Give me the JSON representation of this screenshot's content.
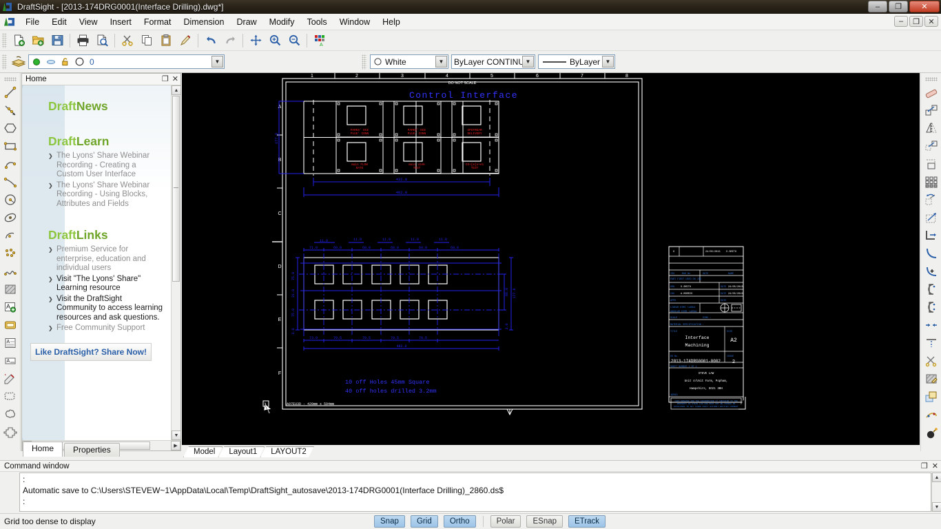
{
  "window": {
    "title": "DraftSight - [2013-174DRG0001(Interface Drilling).dwg*]",
    "minimize": "–",
    "restore": "❐",
    "close": "✕",
    "doc_minimize": "–",
    "doc_restore": "❐",
    "doc_close": "✕"
  },
  "menu": [
    {
      "label": "File"
    },
    {
      "label": "Edit"
    },
    {
      "label": "View"
    },
    {
      "label": "Insert"
    },
    {
      "label": "Format"
    },
    {
      "label": "Dimension"
    },
    {
      "label": "Draw"
    },
    {
      "label": "Modify"
    },
    {
      "label": "Tools"
    },
    {
      "label": "Window"
    },
    {
      "label": "Help"
    }
  ],
  "standard_toolbar": [
    {
      "name": "new-file-icon"
    },
    {
      "name": "open-file-icon"
    },
    {
      "name": "save-icon"
    },
    {
      "name": "print-icon"
    },
    {
      "name": "print-preview-icon"
    },
    {
      "name": "cut-icon"
    },
    {
      "name": "copy-icon"
    },
    {
      "name": "paste-icon"
    },
    {
      "name": "format-painter-icon"
    },
    {
      "name": "undo-icon"
    },
    {
      "name": "redo-icon"
    },
    {
      "name": "pan-icon"
    },
    {
      "name": "zoom-in-icon"
    },
    {
      "name": "zoom-previous-icon"
    },
    {
      "name": "properties-palette-icon"
    }
  ],
  "layer_toolbar": {
    "layers_icon": "layers-icon",
    "current_layer": "0",
    "state_on": "on-indicator",
    "state_frozen": "freeze-indicator",
    "state_locked": "unlock-indicator",
    "state_print": "print-indicator"
  },
  "property_toolbar": {
    "color": "White",
    "linetype": "ByLayer   CONTINU",
    "lineweight": "ByLayer"
  },
  "sidebar": {
    "panel_title": "Home",
    "float_icon": "❐",
    "close_icon": "✕",
    "sections": [
      {
        "prefix": "Draft",
        "suffix": "News",
        "items": []
      },
      {
        "prefix": "Draft",
        "suffix": "Learn",
        "items": [
          "The Lyons' Share Webinar Recording - Creating a Custom User Interface",
          "The Lyons' Share Webinar Recording - Using Blocks, Attributes and Fields"
        ]
      },
      {
        "prefix": "Draft",
        "suffix": "Links",
        "items": [
          "Premium Service for enterprise, education and individual users",
          "Visit \"The Lyons' Share\" Learning resource",
          "Visit the DraftSight Community to access learning resources and ask questions.",
          "Free Community Support"
        ]
      }
    ],
    "share_button": "Like DraftSight? Share Now!",
    "tabs": [
      {
        "label": "Home",
        "active": true
      },
      {
        "label": "Properties",
        "active": false
      }
    ]
  },
  "model_tabs": [
    {
      "label": "Model",
      "active": true
    },
    {
      "label": "Layout1",
      "active": false
    },
    {
      "label": "LAYOUT2",
      "active": false
    }
  ],
  "command_window": {
    "title": "Command window",
    "float_icon": "❐",
    "close_icon": "✕",
    "lines": [
      ":",
      "Automatic save to C:\\Users\\STEVEW~1\\AppData\\Local\\Temp\\DraftSight_autosave\\2013-174DRG0001(Interface Drilling)_2860.ds$",
      ":"
    ]
  },
  "statusbar": {
    "message": "Grid too dense to display",
    "toggles": [
      {
        "label": "Snap",
        "active": true
      },
      {
        "label": "Grid",
        "active": true
      },
      {
        "label": "Ortho",
        "active": true
      },
      {
        "label": "Polar",
        "active": false
      },
      {
        "label": "ESnap",
        "active": false
      },
      {
        "label": "ETrack",
        "active": true
      }
    ]
  },
  "drawing": {
    "do_not_scale": "DO NOT SCALE",
    "sheet_title": "Control Interface",
    "note_line1": "10 off Holes 45mm Square",
    "note_line2": "40 off holes drilled 3.2mm",
    "paper_label": "A97EU3D - 420mm x 594mm",
    "border_columns": [
      "1",
      "2",
      "3",
      "4",
      "5",
      "6",
      "7",
      "8"
    ],
    "border_rows": [
      "A",
      "B",
      "C",
      "D",
      "E",
      "F"
    ],
    "part_labels": [
      "PARKS' DCE PLUG' CONN",
      "PARKS' DCE PLUG' CONN",
      "UPSTREAM DELIVERY",
      "main FLOW RATE",
      "main LEAK TEST",
      "CO+[m]n+e1 TEST"
    ],
    "dimensions_top": {
      "height": "177.8",
      "width_inner": "432.0",
      "width_outer": "482.0"
    },
    "dimensions_bottom": {
      "horizontal": [
        "73.0",
        "70.5",
        "70.5",
        "70.5",
        "70.5"
      ],
      "top_small": [
        "11.0",
        "11.0",
        "11.0",
        "11.0"
      ],
      "top_row": [
        "71.0",
        "60.0",
        "68.0",
        "68.0",
        "60.0",
        "68.0"
      ],
      "vertical_left": [
        "75.0",
        "31.0",
        "75.0",
        "3.0"
      ],
      "vertical_right": [
        "177.8",
        "86.0",
        "3.0"
      ],
      "overall": "482.0"
    },
    "title_block": {
      "rev_col": "0",
      "rev_date": "24/05/2013",
      "rev_by": "S.SMITH",
      "scale_label": "SCALE:",
      "material_label": "MATERIAL SPECIFICATION:",
      "title_label": "TITLE",
      "title_line1": "Interface",
      "title_line2": "Machining",
      "sheet_size": "A2",
      "dsno_label": "DS No.",
      "dsno_value": "2013-174DRG0001-0002",
      "issue_label": "ISSUE",
      "issue_value": "2",
      "sheet_number": "SHEET NUMBER 1 OF 1",
      "company": "STEVE LAW",
      "address_line1": "Unit 4/Unit Farm, Popham,",
      "address_line2": "Hampshire, SO21 3BH",
      "rows": [
        {
          "label": "DRAWN",
          "name": "S.SMITH",
          "date_label": "DATE",
          "date": "24/05/2013"
        },
        {
          "label": "CHECKED",
          "name": "A.MORRIS",
          "date_label": "DATE",
          "date": "24/05/2013"
        },
        {
          "label": "APPROVED",
          "name": "",
          "date_label": "DATE",
          "date": ""
        }
      ],
      "tolerance_line1": "LINEAR DIMS ±",
      "tolerance_line2": "ANGULAR DIMS ±",
      "third_angle_icon": "third-angle-projection-icon",
      "disclaimer": "THIS DRAWING AND THE INFORMATION IT CONTAINS IS THE PROPERTY OF STEVE LAW AND MUST NOT BE COPIED OR DISCLOSED"
    }
  },
  "colors": {
    "canvas_bg": "#000000",
    "cad_white": "#ffffff",
    "cad_blue": "#2222ee",
    "cad_red": "#ee1111",
    "brand_green": "#8cc63e",
    "link_blue": "#2b5fa8",
    "toggle_on": "#9cc4e8"
  }
}
